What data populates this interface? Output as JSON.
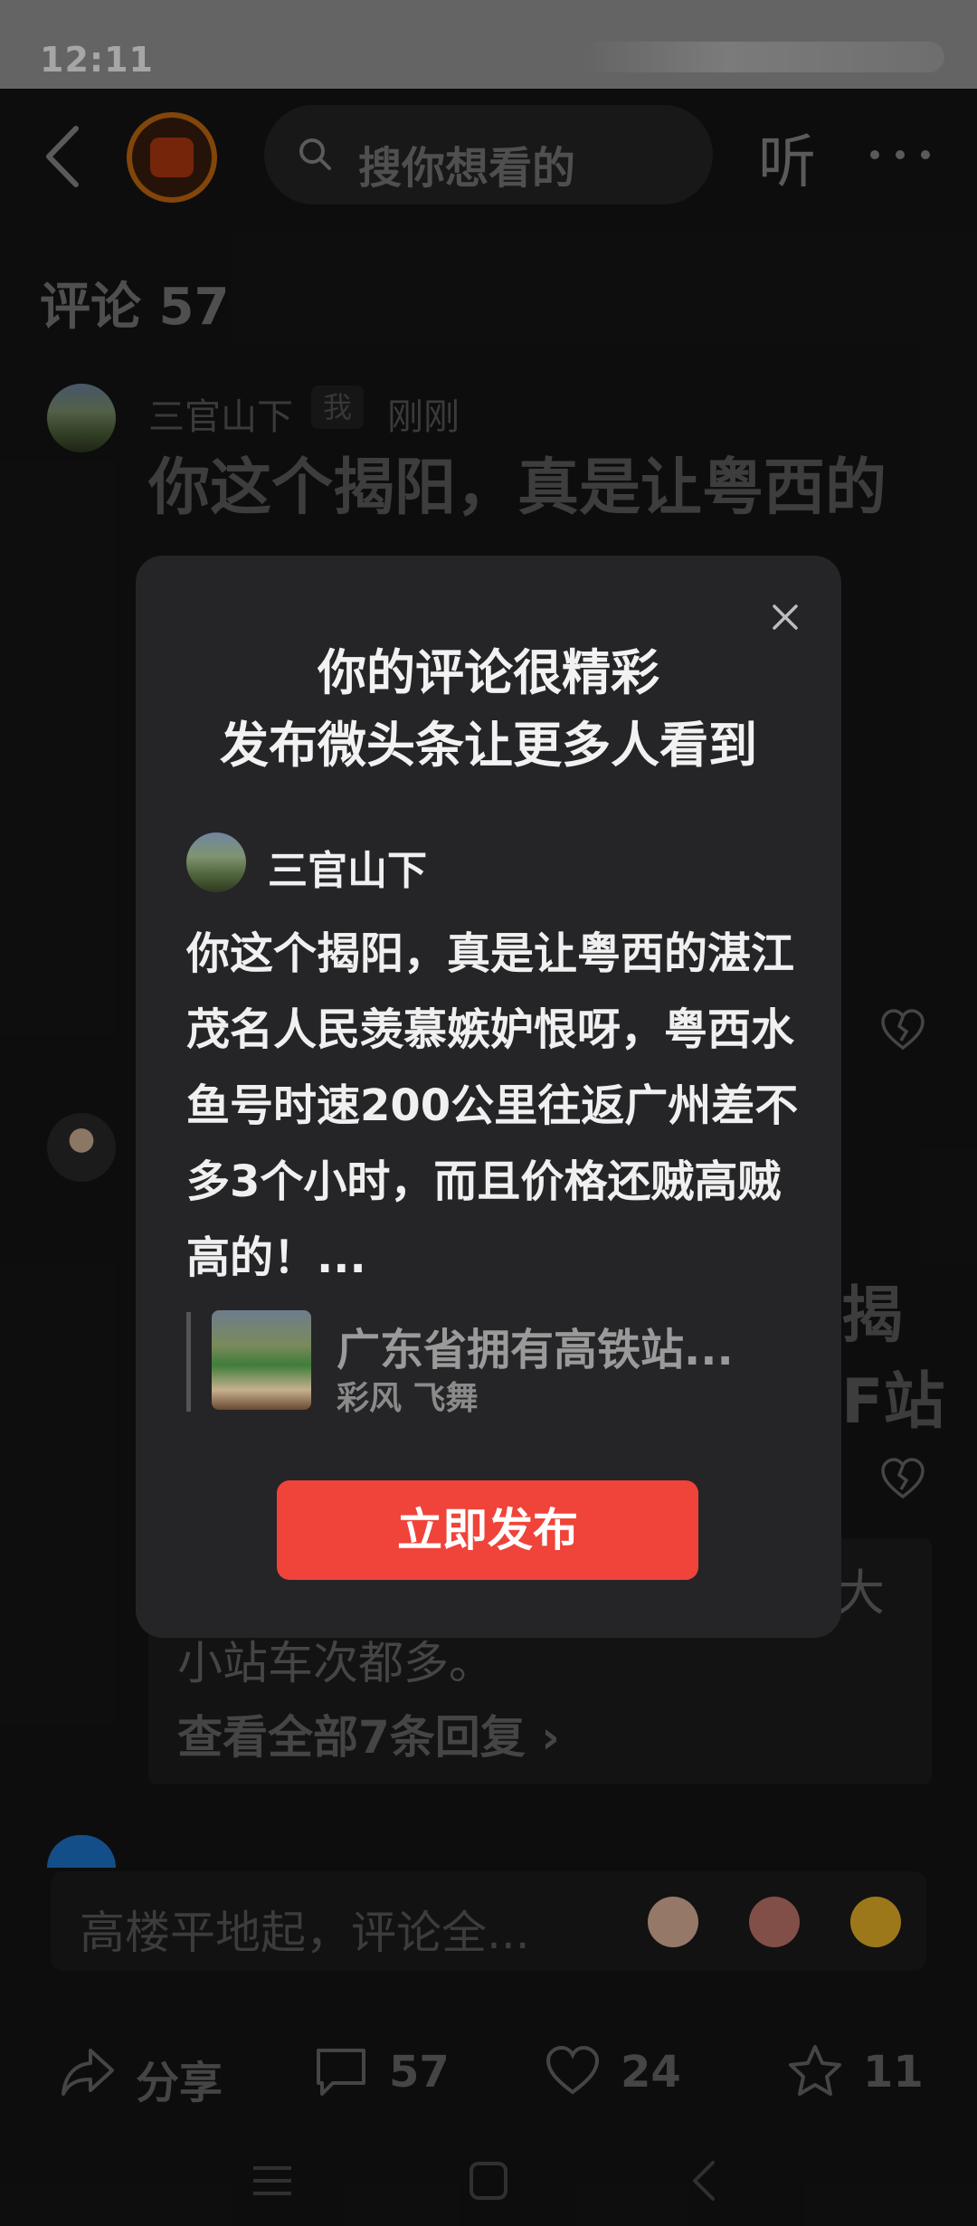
{
  "status_bar": {
    "time": "12:11"
  },
  "header": {
    "search_placeholder": "搜你想看的",
    "listen_label": "听"
  },
  "comments": {
    "title": "评论 57",
    "first": {
      "author": "三官山下",
      "me_badge": "我",
      "time": "刚刚",
      "text_visible": "你这个揭阳，真是让粤西的"
    },
    "second_fragments": [
      "揭",
      "F站"
    ],
    "reply": {
      "fragment_right": "大",
      "line2": "小站车次都多。",
      "see_all": "查看全部7条回复",
      "chevron": "›"
    }
  },
  "composer": {
    "placeholder": "高楼平地起，评论全..."
  },
  "actions": {
    "share_label": "分享",
    "comment_count": "57",
    "like_count": "24",
    "fav_count": "11"
  },
  "modal": {
    "title_line1": "你的评论很精彩",
    "title_line2": "发布微头条让更多人看到",
    "author": "三官山下",
    "body": "你这个揭阳，真是让粤西的湛江茂名人民羡慕嫉妒恨呀，粤西水鱼号时速200公里往返广州差不多3个小时，而且价格还贼高贼高的！...",
    "quote_title": "广东省拥有高铁站...",
    "quote_source": "彩风 飞舞",
    "publish_button": "立即发布"
  },
  "icons": {
    "back": "back-arrow-icon",
    "search": "search-icon",
    "more": "more-dots-icon",
    "close": "close-icon",
    "share": "share-icon",
    "comment": "comment-icon",
    "like": "heart-icon",
    "favorite": "star-icon",
    "dislike": "broken-heart-icon"
  },
  "colors": {
    "accent_red": "#f0433a",
    "modal_bg": "#252528",
    "page_bg": "#151515"
  }
}
